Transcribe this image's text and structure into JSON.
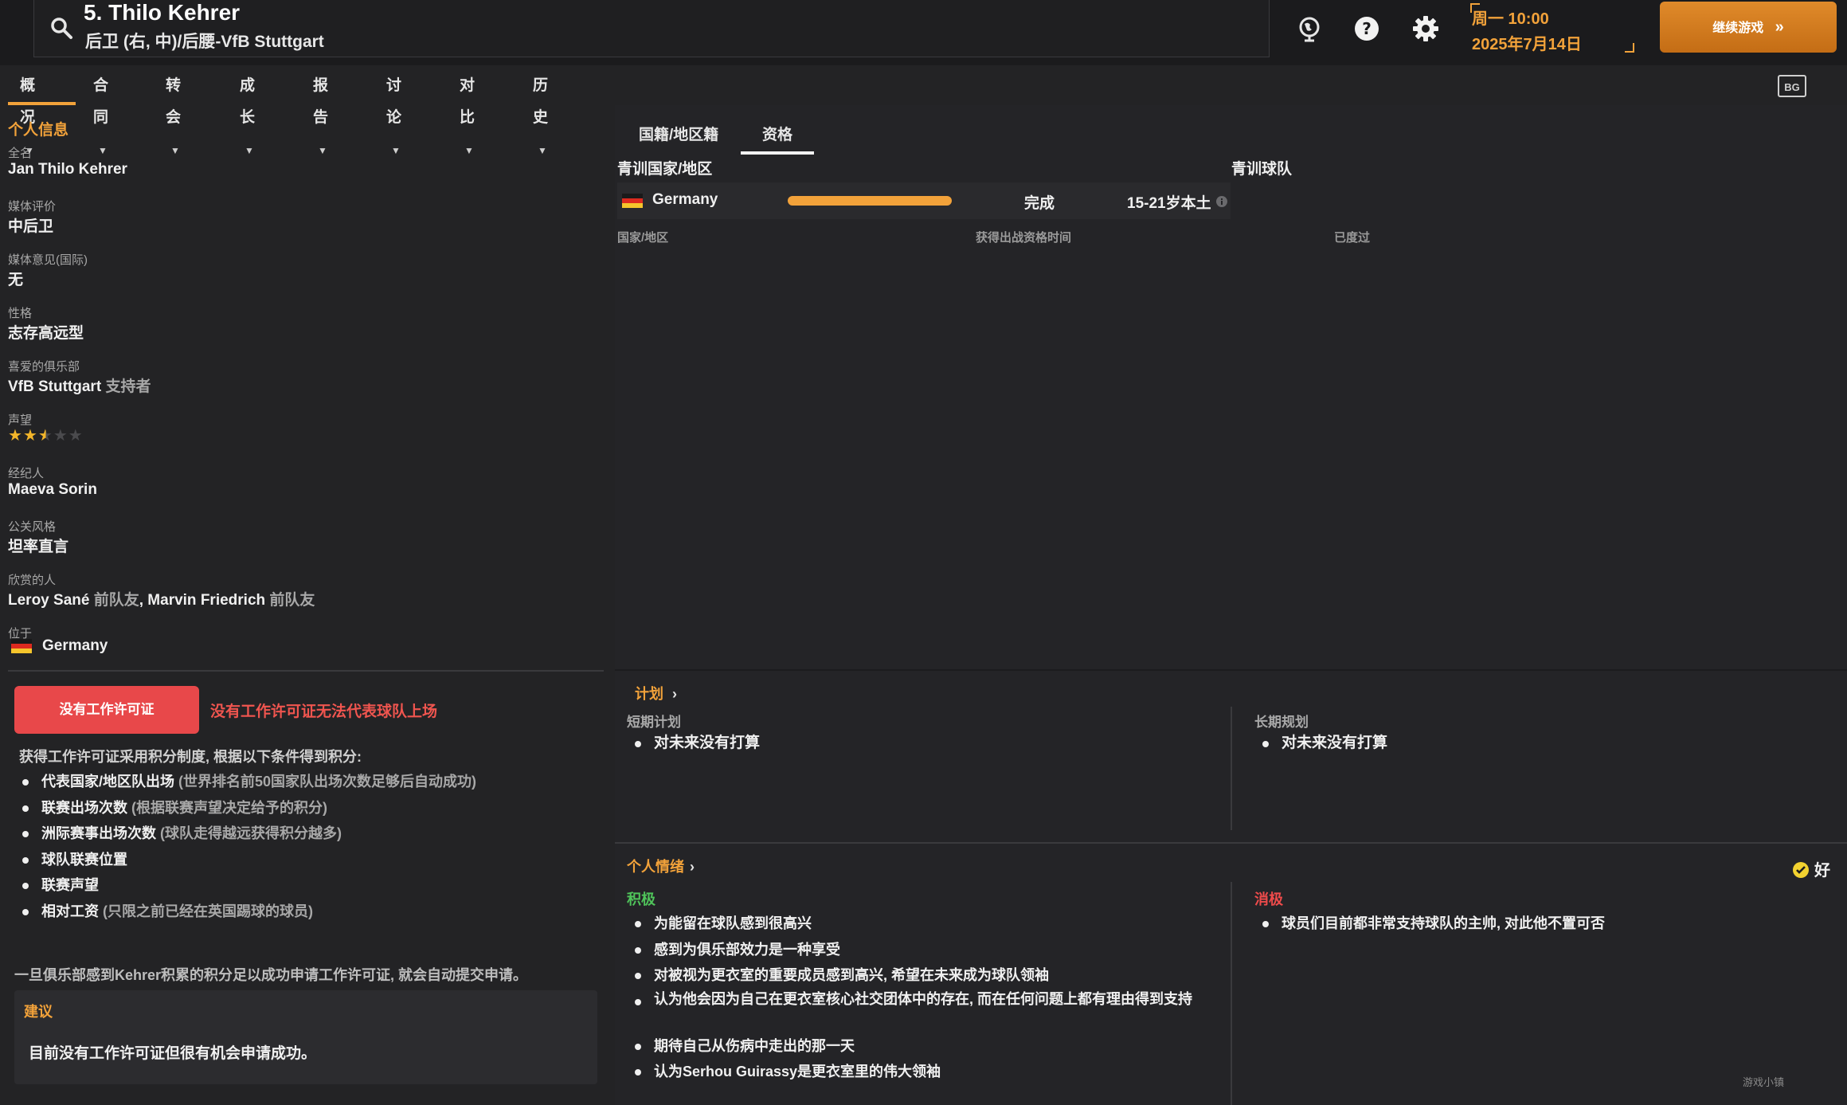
{
  "header": {
    "title": "5. Thilo Kehrer",
    "subtitle": "后卫 (右, 中)/后腰-VfB Stuttgart",
    "date_line1": "周一 10:00",
    "date_line2": "2025年7月14日",
    "continue_label": "继续游戏",
    "icons": [
      "search-icon",
      "globe-icon",
      "help-icon",
      "gear-icon"
    ],
    "bg_button_label": "BG"
  },
  "menu": {
    "items": [
      {
        "label": "概况"
      },
      {
        "label": "合同"
      },
      {
        "label": "转会"
      },
      {
        "label": "成长"
      },
      {
        "label": "报告"
      },
      {
        "label": "讨论"
      },
      {
        "label": "对比"
      },
      {
        "label": "历史"
      }
    ],
    "active_index": 0
  },
  "personal_info": {
    "section_title": "个人信息",
    "fields": [
      {
        "label": "全名",
        "value": "Jan Thilo Kehrer"
      },
      {
        "label": "媒体评价",
        "value": "中后卫"
      },
      {
        "label": "媒体意见(国际)",
        "value": "无"
      },
      {
        "label": "性格",
        "value": "志存高远型"
      },
      {
        "label": "喜爱的俱乐部",
        "value": "VfB Stuttgart",
        "suffix": "支持者"
      },
      {
        "label": "声望",
        "stars": 2.5,
        "max_stars": 5
      },
      {
        "label": "经纪人",
        "value": "Maeva Sorin"
      },
      {
        "label": "公关风格",
        "value": "坦率直言"
      },
      {
        "label": "欣赏的人",
        "value_a": "Leroy Sané",
        "suffix_a": "前队友",
        "value_b": "Marvin Friedrich",
        "suffix_b": "前队友",
        "separator": ","
      },
      {
        "label": "位于",
        "value": "Germany"
      }
    ]
  },
  "work_permit": {
    "button_label": "没有工作许可证",
    "note": "没有工作许可证无法代表球队上场",
    "intro": "获得工作许可证采用积分制度, 根据以下条件得到积分:",
    "criteria": [
      {
        "main": "代表国家/地区队出场",
        "detail": "(世界排名前50国家队出场次数足够后自动成功)"
      },
      {
        "main": "联赛出场次数",
        "detail": "(根据联赛声望决定给予的积分)"
      },
      {
        "main": "洲际赛事出场次数",
        "detail": "(球队走得越远获得积分越多)"
      },
      {
        "main": "球队联赛位置",
        "detail": ""
      },
      {
        "main": "联赛声望",
        "detail": ""
      },
      {
        "main": "相对工资",
        "detail": "(只限之前已经在英国踢球的球员)"
      }
    ],
    "footer": "一旦俱乐部感到Kehrer积累的积分足以成功申请工作许可证, 就会自动提交申请。",
    "advice_title": "建议",
    "advice_text": "目前没有工作许可证但很有机会申请成功。"
  },
  "eligibility": {
    "tabs": [
      {
        "label": "国籍/地区籍"
      },
      {
        "label": "资格"
      }
    ],
    "active_tab": 1,
    "youth_country_header": "青训国家/地区",
    "youth_club_header": "青训球队",
    "row": {
      "country": "Germany",
      "progress": 1.0,
      "status": "完成",
      "category": "15-21岁本土"
    },
    "table_headers": [
      "国家/地区",
      "获得出战资格时间",
      "已度过"
    ]
  },
  "plans": {
    "title": "计划",
    "short_label": "短期计划",
    "short_items": [
      "对未来没有打算"
    ],
    "long_label": "长期规划",
    "long_items": [
      "对未来没有打算"
    ]
  },
  "mood": {
    "title": "个人情绪",
    "status": "好",
    "positive_label": "积极",
    "positive_items": [
      "为能留在球队感到很高兴",
      "感到为俱乐部效力是一种享受",
      "对被视为更衣室的重要成员感到高兴, 希望在未来成为球队领袖",
      "认为他会因为自己在更衣室核心社交团体中的存在, 而在任何问题上都有理由得到支持",
      "期待自己从伤病中走出的那一天",
      "认为Serhou Guirassy是更衣室里的伟大领袖"
    ],
    "negative_label": "消极",
    "negative_items": [
      "球员们目前都非常支持球队的主帅, 对此他不置可否"
    ]
  },
  "colors": {
    "accent": "#f2a23a",
    "danger": "#e8484a",
    "positive": "#4fc35a",
    "background": "#232325"
  },
  "watermark": "游戏小镇"
}
